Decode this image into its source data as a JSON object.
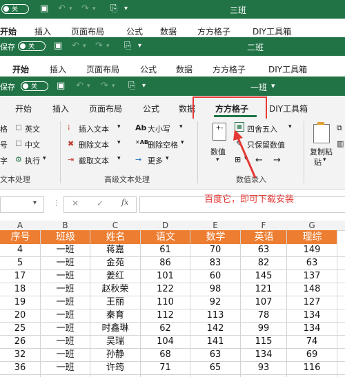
{
  "accent": "#217346",
  "highlight_color": "#e53935",
  "header_color": "#ed7d31",
  "windows": [
    {
      "toggle": "关",
      "title": "三班"
    },
    {
      "toggle": "关",
      "title": "二班"
    },
    {
      "toggle": "关",
      "title": "一班",
      "chev": "▾",
      "save_label": "保存"
    }
  ],
  "tabs_back1": [
    "开始",
    "插入",
    "页面布局",
    "公式",
    "数据",
    "方方格子",
    "DIY工具箱"
  ],
  "tabs_back2": [
    "开始",
    "插入",
    "页面布局",
    "公式",
    "数据",
    "方方格子",
    "DIY工具箱"
  ],
  "tabs_main": [
    "开始",
    "插入",
    "页面布局",
    "公式",
    "数据",
    "方方格子",
    "DIY工具箱"
  ],
  "ribbon": {
    "left": {
      "r1a": "格",
      "r1b": "英文",
      "r2a": "号",
      "r2b": "中文",
      "r3a": "字",
      "r3b": "执行",
      "group": "文本处理"
    },
    "advanced": {
      "insert_text": "插入文本",
      "delete_text": "删除文本",
      "extract_text": "截取文本",
      "case": "大小写",
      "delete_space": "删除空格",
      "more": "更多",
      "group": "高级文本处理"
    },
    "data_entry": {
      "value": "数值",
      "round": "四舍五入",
      "keep_value": "只保留数值",
      "group": "数值录入"
    },
    "copy_paste": {
      "line1": "复制粘",
      "line2": "贴"
    }
  },
  "formula_bar": {
    "cancel": "✕",
    "confirm": "✓",
    "fx": "fx"
  },
  "annotation": "百度它，即可下载安装",
  "columns": [
    "A",
    "B",
    "C",
    "D",
    "E",
    "F",
    "G"
  ],
  "headers": [
    "序号",
    "班级",
    "姓名",
    "语文",
    "数学",
    "英语",
    "理综"
  ],
  "rows": [
    [
      "4",
      "一班",
      "蒋嘉",
      "61",
      "70",
      "63",
      "149"
    ],
    [
      "5",
      "一班",
      "金苑",
      "86",
      "83",
      "82",
      "63"
    ],
    [
      "17",
      "一班",
      "姜红",
      "101",
      "60",
      "145",
      "137"
    ],
    [
      "18",
      "一班",
      "赵秋荣",
      "122",
      "98",
      "121",
      "148"
    ],
    [
      "19",
      "一班",
      "王丽",
      "110",
      "92",
      "107",
      "127"
    ],
    [
      "20",
      "一班",
      "秦育",
      "112",
      "113",
      "78",
      "134"
    ],
    [
      "25",
      "一班",
      "时鑫琳",
      "62",
      "142",
      "99",
      "134"
    ],
    [
      "26",
      "一班",
      "吴瑞",
      "104",
      "141",
      "115",
      "74"
    ],
    [
      "32",
      "一班",
      "孙静",
      "68",
      "63",
      "134",
      "69"
    ],
    [
      "36",
      "一班",
      "许筠",
      "71",
      "65",
      "93",
      "116"
    ]
  ]
}
